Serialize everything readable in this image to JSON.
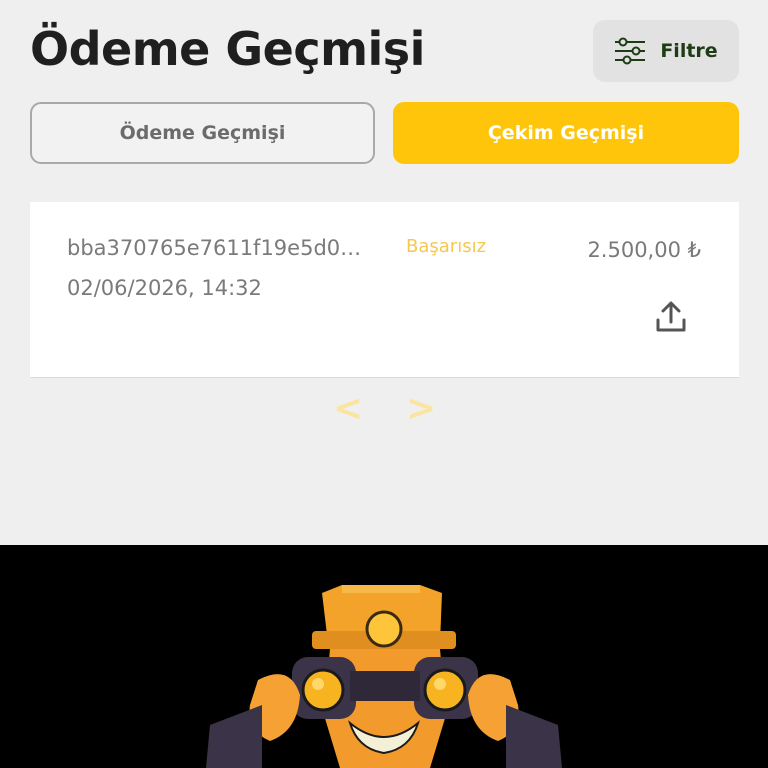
{
  "header": {
    "title": "Ödeme Geçmişi",
    "filter_label": "Filtre"
  },
  "tabs": [
    {
      "label": "Ödeme Geçmişi",
      "active": false
    },
    {
      "label": "Çekim Geçmişi",
      "active": true
    }
  ],
  "transactions": [
    {
      "id": "bba370765e7611f19e5d0…",
      "date": "02/06/2026, 14:32",
      "status": "Başarısız",
      "amount": "2.500,00 ₺"
    }
  ],
  "pagination": {
    "prev": "<",
    "next": ">"
  },
  "colors": {
    "accent": "#fec50b",
    "background": "#efefef",
    "status_failed": "#f6c850",
    "title": "#1f1f1f"
  },
  "icons": [
    "filter-sliders-icon",
    "share-upload-icon"
  ],
  "banner": {
    "image": "mascot-with-binoculars"
  }
}
